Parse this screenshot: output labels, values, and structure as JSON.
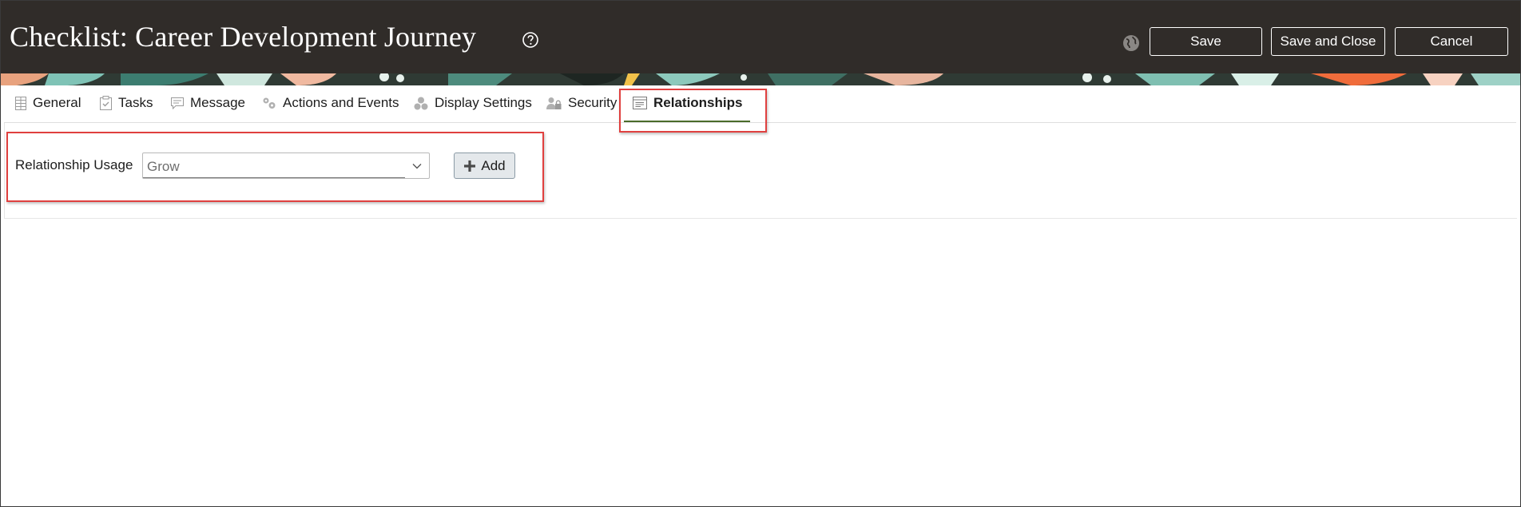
{
  "header": {
    "title": "Checklist: Career Development Journey",
    "help_icon": "help-circle-icon",
    "globe_icon": "globe-icon",
    "buttons": {
      "save": "Save",
      "save_and_close": "Save and Close",
      "cancel": "Cancel"
    }
  },
  "tabs": [
    {
      "label": "General",
      "icon": "grid-icon"
    },
    {
      "label": "Tasks",
      "icon": "clipboard-check-icon"
    },
    {
      "label": "Message",
      "icon": "speech-bubble-icon"
    },
    {
      "label": "Actions and Events",
      "icon": "gears-icon"
    },
    {
      "label": "Display Settings",
      "icon": "circles-icon"
    },
    {
      "label": "Security",
      "icon": "user-lock-icon"
    },
    {
      "label": "Relationships",
      "icon": "document-list-icon",
      "active": true
    }
  ],
  "relationships": {
    "usage_label": "Relationship Usage",
    "usage_value": "Grow",
    "add_label": "Add"
  },
  "colors": {
    "header_bg": "#302c29",
    "active_tab_underline": "#4a6b2a",
    "highlight": "#e0403f"
  }
}
